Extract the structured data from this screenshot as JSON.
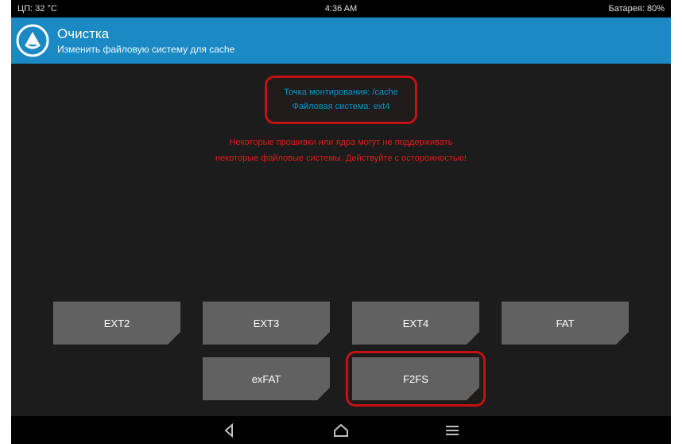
{
  "status": {
    "cpu": "ЦП: 32 °C",
    "time": "4:36 AM",
    "battery": "Батарея: 80%"
  },
  "header": {
    "title": "Очистка",
    "subtitle": "Изменить файловую систему для cache"
  },
  "info": {
    "mount": "Точка монтирования: /cache",
    "fs": "Файловая система: ext4"
  },
  "warning": {
    "l1": "Некоторые прошивки или ядра могут не поддерживать",
    "l2": "некоторые файловые системы. Действуйте с осторожностью!"
  },
  "buttons": {
    "ext2": "EXT2",
    "ext3": "EXT3",
    "ext4": "EXT4",
    "fat": "FAT",
    "exfat": "exFAT",
    "f2fs": "F2FS"
  },
  "colors": {
    "accent": "#1a89c4",
    "danger": "#c41111",
    "info_text": "#0097c9"
  }
}
